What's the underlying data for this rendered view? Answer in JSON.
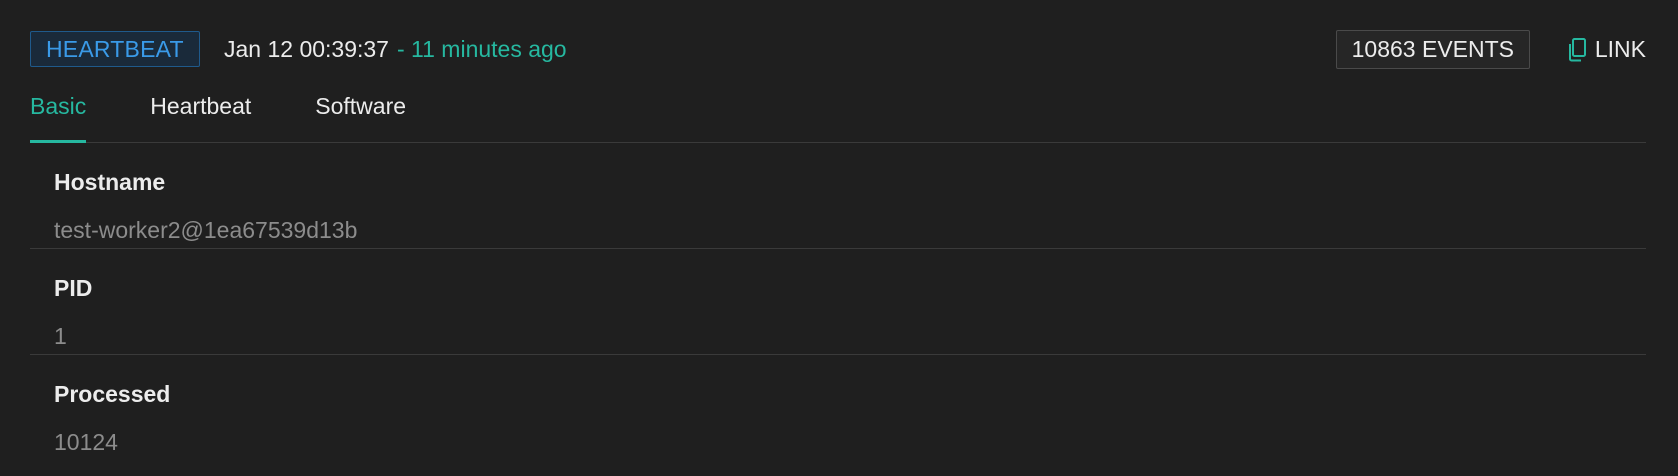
{
  "header": {
    "badge": "HEARTBEAT",
    "date": "Jan 12 00:39:37",
    "ago": "- 11 minutes ago",
    "events_button": "10863 EVENTS",
    "link_label": "LINK",
    "link_icon": "copy-icon"
  },
  "tabs": [
    {
      "label": "Basic",
      "active": true
    },
    {
      "label": "Heartbeat",
      "active": false
    },
    {
      "label": "Software",
      "active": false
    }
  ],
  "rows": [
    {
      "label": "Hostname",
      "value": "test-worker2@1ea67539d13b"
    },
    {
      "label": "PID",
      "value": "1"
    },
    {
      "label": "Processed",
      "value": "10124"
    }
  ],
  "colors": {
    "accent": "#26b8a0",
    "badge_text": "#3a9ae8",
    "background": "#1f1f1f"
  }
}
